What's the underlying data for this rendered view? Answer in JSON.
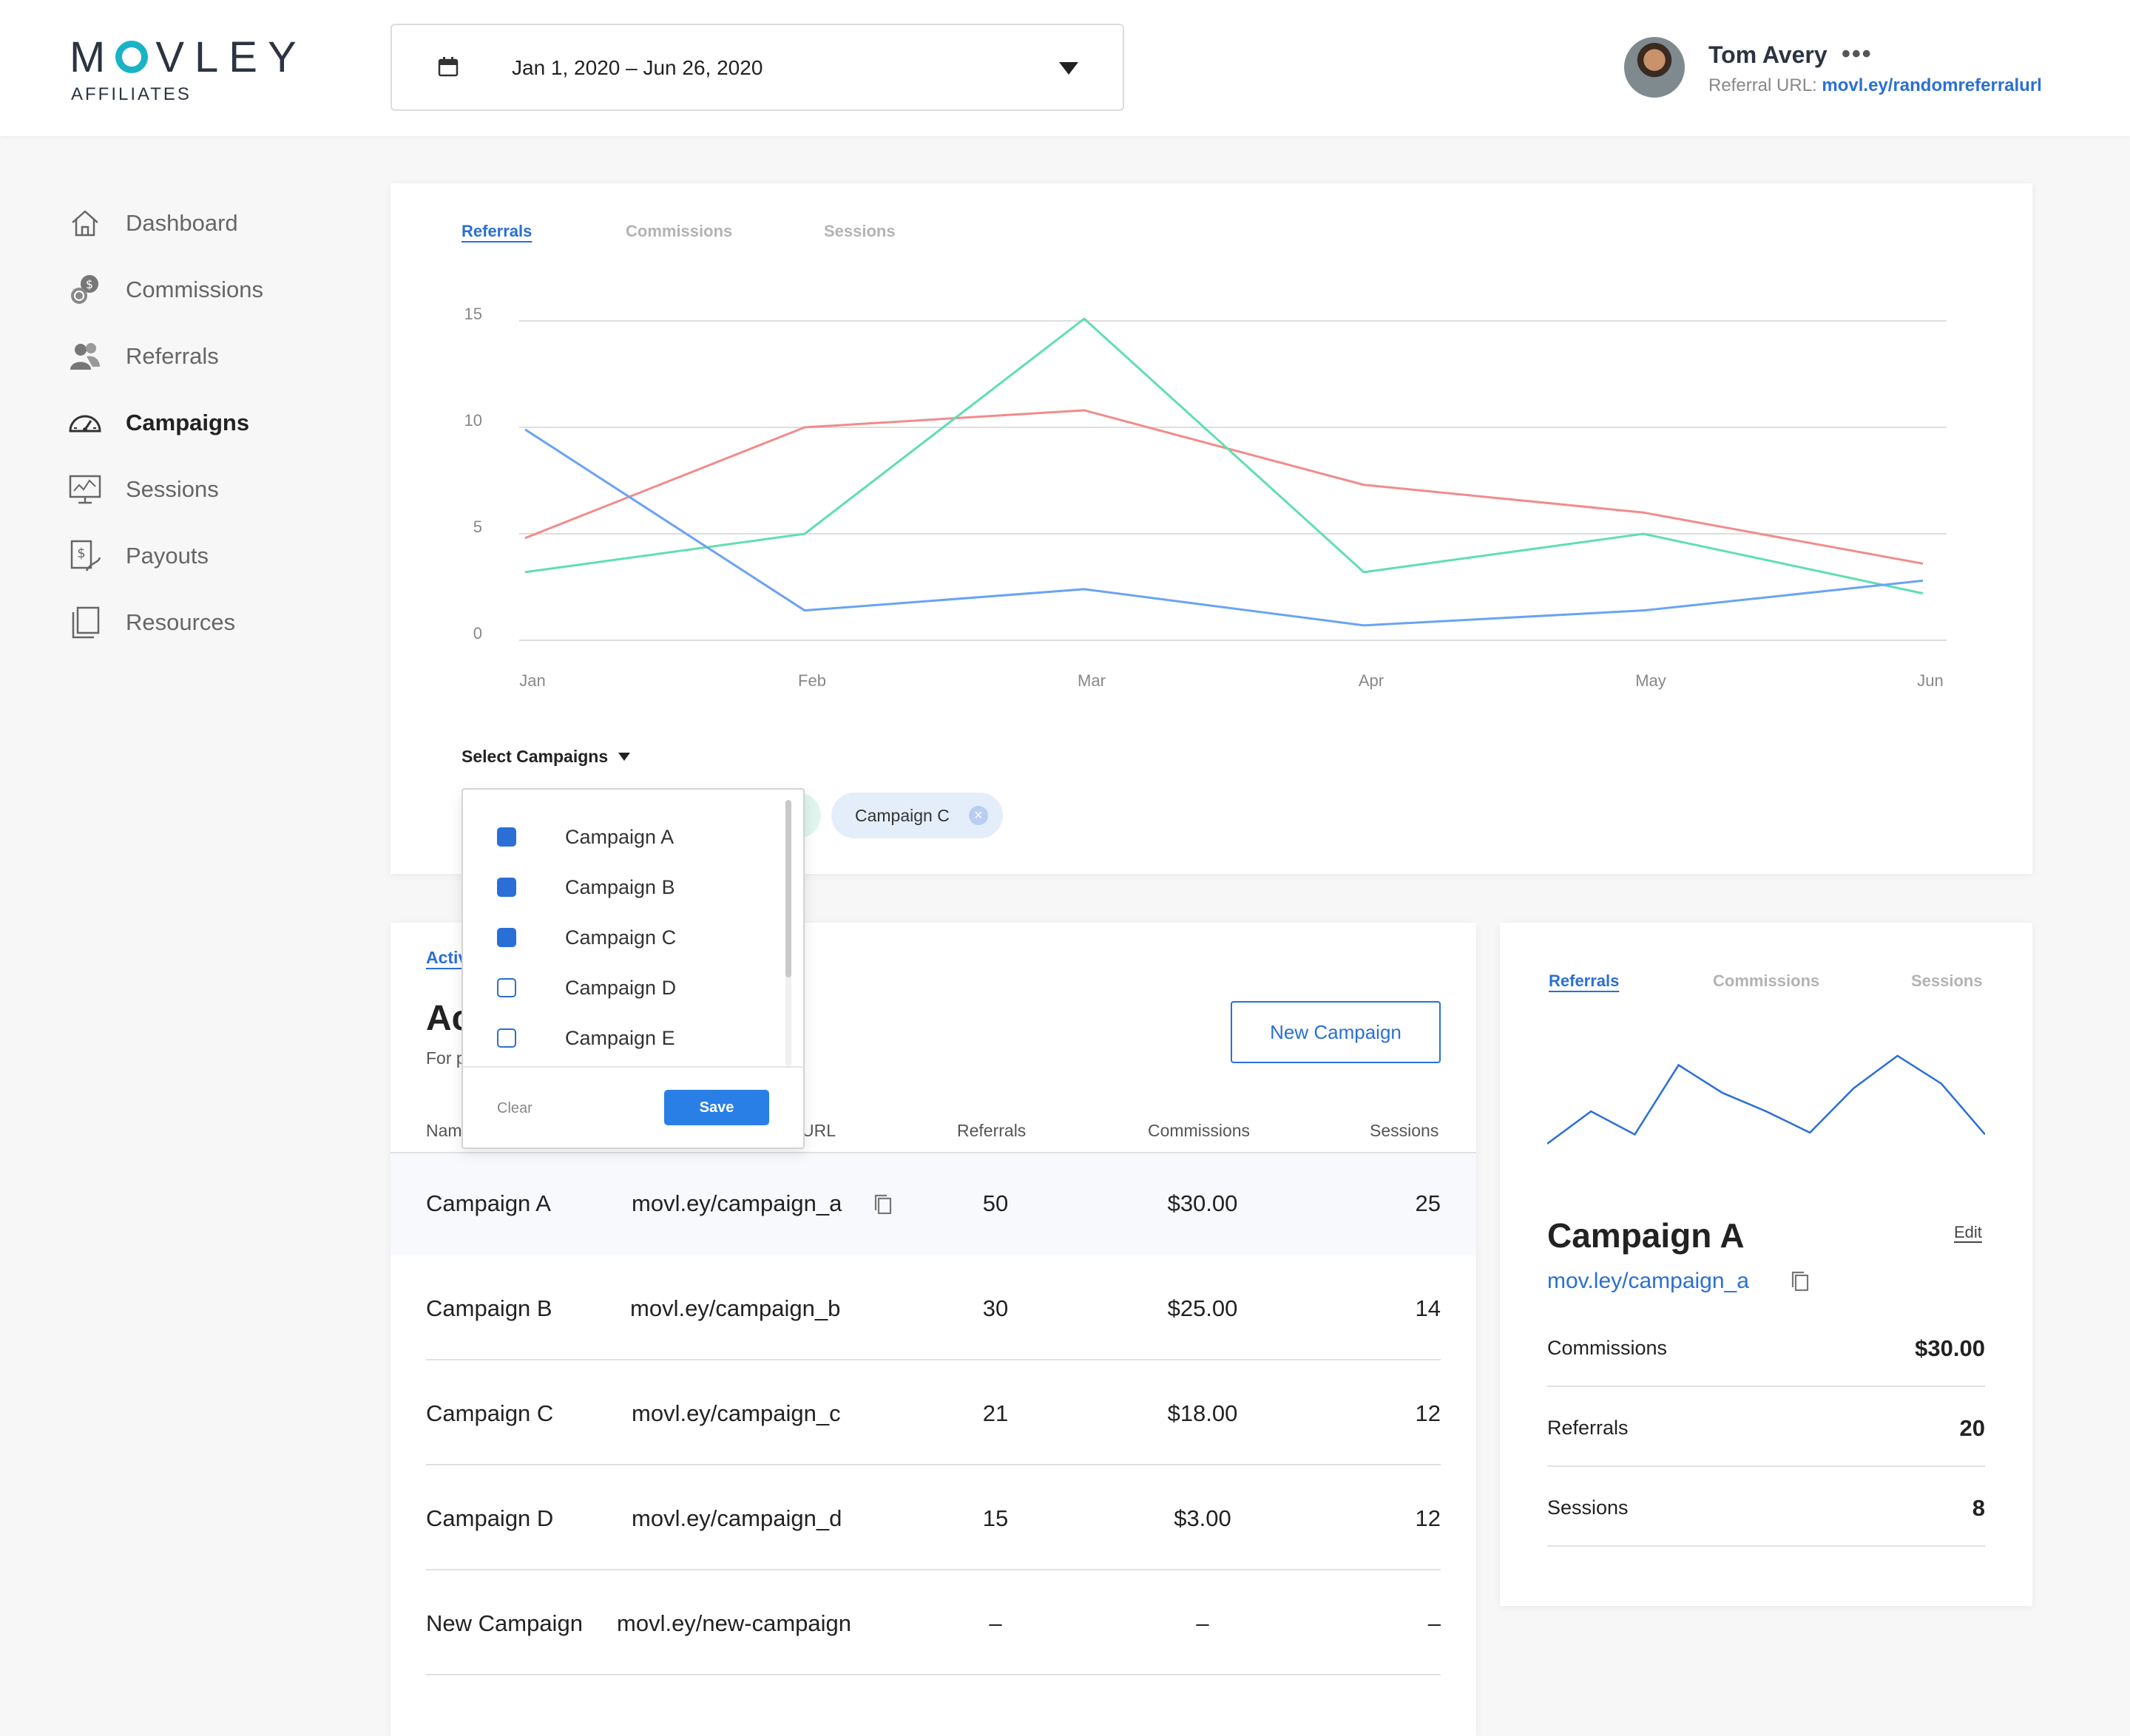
{
  "header": {
    "logo_text": "MOVLEY",
    "logo_sub": "AFFILIATES",
    "date_range": "Jan 1, 2020 – Jun 26, 2020",
    "user_name": "Tom Avery",
    "more_label": "•••",
    "referral_label": "Referral URL:",
    "referral_url": "movl.ey/randomreferralurl"
  },
  "sidebar": {
    "items": [
      {
        "label": "Dashboard",
        "icon": "home-icon"
      },
      {
        "label": "Commissions",
        "icon": "coins-icon"
      },
      {
        "label": "Referrals",
        "icon": "users-icon"
      },
      {
        "label": "Campaigns",
        "icon": "gauge-icon",
        "active": true
      },
      {
        "label": "Sessions",
        "icon": "monitor-chart-icon"
      },
      {
        "label": "Payouts",
        "icon": "payout-icon"
      },
      {
        "label": "Resources",
        "icon": "documents-icon"
      }
    ]
  },
  "main_chart": {
    "tabs": [
      "Referrals",
      "Commissions",
      "Sessions"
    ],
    "active_tab": "Referrals",
    "select_label": "Select Campaigns",
    "chips": [
      "Campaign C"
    ],
    "colors": {
      "red": "#f28b8b",
      "green": "#5fdfb0",
      "blue": "#6aa3f5"
    }
  },
  "chart_data": {
    "type": "line",
    "categories": [
      "Jan",
      "Feb",
      "Mar",
      "Apr",
      "May",
      "Jun"
    ],
    "ylim": [
      0,
      15
    ],
    "yticks": [
      0,
      5,
      10,
      15
    ],
    "grid": true,
    "series": [
      {
        "color": "#f28b8b",
        "values": [
          4.8,
          10,
          10.8,
          7.3,
          6,
          3.6
        ]
      },
      {
        "color": "#5fdfb0",
        "values": [
          3.2,
          5,
          15.1,
          3.2,
          5,
          2.2
        ]
      },
      {
        "color": "#6aa3f5",
        "values": [
          9.9,
          1.4,
          2.4,
          0.7,
          1.4,
          2.8
        ]
      }
    ]
  },
  "dropdown": {
    "items": [
      {
        "label": "Campaign A",
        "checked": true
      },
      {
        "label": "Campaign B",
        "checked": true
      },
      {
        "label": "Campaign C",
        "checked": true
      },
      {
        "label": "Campaign D",
        "checked": false
      },
      {
        "label": "Campaign E",
        "checked": false
      }
    ],
    "clear_label": "Clear",
    "save_label": "Save"
  },
  "campaigns_card": {
    "tab_partial": "Activ",
    "title_partial": "Ac",
    "subtitle_partial": "For p",
    "new_button": "New Campaign",
    "headers": {
      "name": "Nam",
      "url": "URL",
      "referrals": "Referrals",
      "commissions": "Commissions",
      "sessions": "Sessions"
    },
    "rows": [
      {
        "name": "Campaign A",
        "url": "movl.ey/campaign_a",
        "referrals": "50",
        "commissions": "$30.00",
        "sessions": "25"
      },
      {
        "name": "Campaign B",
        "url": "movl.ey/campaign_b",
        "referrals": "30",
        "commissions": "$25.00",
        "sessions": "14"
      },
      {
        "name": "Campaign C",
        "url": "movl.ey/campaign_c",
        "referrals": "21",
        "commissions": "$18.00",
        "sessions": "12"
      },
      {
        "name": "Campaign D",
        "url": "movl.ey/campaign_d",
        "referrals": "15",
        "commissions": "$3.00",
        "sessions": "12"
      },
      {
        "name": "New Campaign",
        "url": "movl.ey/new-campaign",
        "referrals": "–",
        "commissions": "–",
        "sessions": "–"
      }
    ]
  },
  "detail_card": {
    "tabs": [
      "Referrals",
      "Commissions",
      "Sessions"
    ],
    "active_tab": "Referrals",
    "sparkline": [
      2,
      5.5,
      3,
      10.5,
      7.5,
      5.5,
      3.2,
      8,
      11.5,
      8.5,
      3
    ],
    "sparkline_color": "#2a6fd6",
    "title": "Campaign A",
    "edit_label": "Edit",
    "url": "mov.ley/campaign_a",
    "stats": [
      {
        "label": "Commissions",
        "value": "$30.00"
      },
      {
        "label": "Referrals",
        "value": "20"
      },
      {
        "label": "Sessions",
        "value": "8"
      }
    ]
  }
}
